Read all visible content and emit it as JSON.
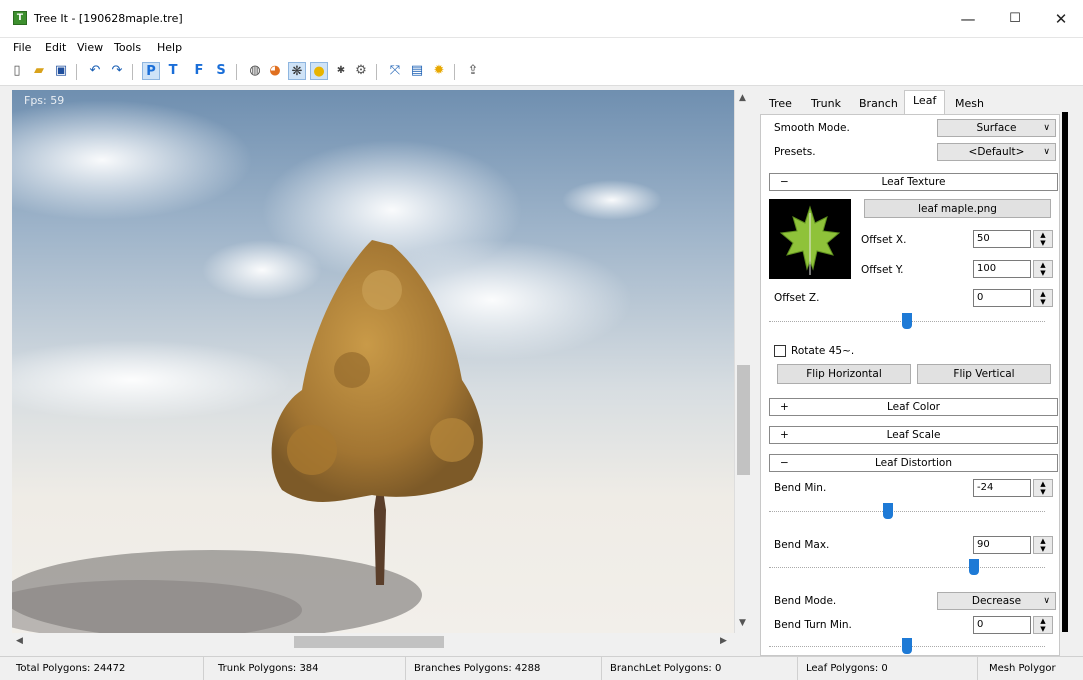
{
  "window": {
    "title": "Tree It - [190628maple.tre]",
    "icon": "tree-app-icon",
    "minimize": "—",
    "maximize": "☐",
    "close": "✕"
  },
  "menu": [
    "File",
    "Edit",
    "View",
    "Tools",
    "Help"
  ],
  "toolbar": {
    "icons": [
      "new-file-icon",
      "open-folder-icon",
      "save-icon",
      "undo-icon",
      "redo-icon",
      "perspective-view-button",
      "top-view-button",
      "front-view-button",
      "side-view-button",
      "wire-icon",
      "color-icon",
      "leaf-icon",
      "light-icon",
      "point-icon",
      "bones-icon",
      "expand-icon",
      "screen-icon",
      "sun-icon",
      "export-icon"
    ],
    "view_letters": [
      "P",
      "T",
      "F",
      "S"
    ]
  },
  "viewport": {
    "fps_label": "Fps: 59"
  },
  "tabs": [
    "Tree",
    "Trunk",
    "Branch",
    "Leaf",
    "Mesh"
  ],
  "active_tab": "Leaf",
  "leaf_panel": {
    "smooth_mode": {
      "label": "Smooth Mode.",
      "value": "Surface"
    },
    "presets": {
      "label": "Presets.",
      "value": "<Default>"
    },
    "leaf_texture": {
      "header": "Leaf Texture",
      "sign": "−",
      "file_button": "leaf maple.png",
      "offset_x": {
        "label": "Offset X.",
        "value": "50"
      },
      "offset_y": {
        "label": "Offset Y.",
        "value": "100"
      },
      "offset_z": {
        "label": "Offset Z.",
        "value": "0",
        "slider_fraction": 0.5
      },
      "rotate_label": "Rotate 45~.",
      "rotate_checked": false,
      "flip_h": "Flip Horizontal",
      "flip_v": "Flip Vertical"
    },
    "leaf_color": {
      "header": "Leaf Color",
      "sign": "+"
    },
    "leaf_scale": {
      "header": "Leaf Scale",
      "sign": "+"
    },
    "leaf_distortion": {
      "header": "Leaf Distortion",
      "sign": "−",
      "bend_min": {
        "label": "Bend Min.",
        "value": "-24",
        "slider_fraction": 0.43
      },
      "bend_max": {
        "label": "Bend Max.",
        "value": "90",
        "slider_fraction": 0.75
      },
      "bend_mode": {
        "label": "Bend Mode.",
        "value": "Decrease"
      },
      "bend_turn_min": {
        "label": "Bend Turn Min.",
        "value": "0",
        "slider_fraction": 0.5
      }
    }
  },
  "status": {
    "total": "Total Polygons: 24472",
    "trunk": "Trunk Polygons: 384",
    "branches": "Branches Polygons: 4288",
    "branchlet": "BranchLet Polygons: 0",
    "leaf": "Leaf Polygons: 0",
    "mesh": "Mesh Polygor"
  },
  "colors": {
    "accent": "#1e7ad6",
    "tree_foliage": "#b88a3a",
    "sky": "#9db3c9"
  }
}
